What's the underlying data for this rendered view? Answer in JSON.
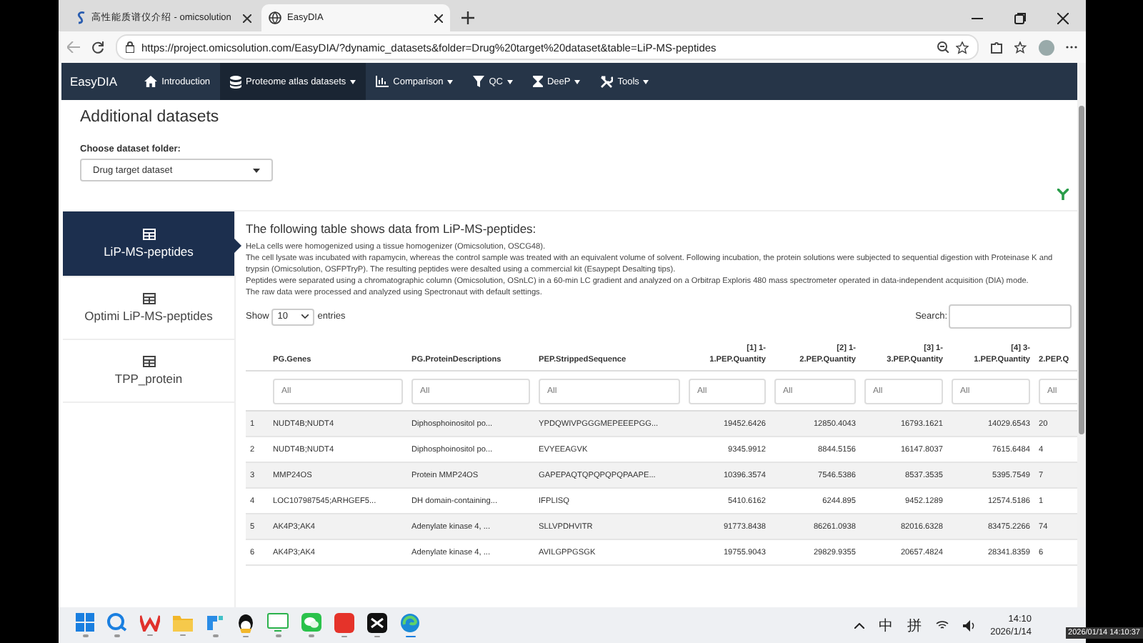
{
  "browser": {
    "tabs": [
      {
        "title": "高性能质谱仪介绍 - omicsolution",
        "selected": false
      },
      {
        "title": "EasyDIA",
        "selected": true
      }
    ],
    "url": "https://project.omicsolution.com/EasyDIA/?dynamic_datasets&folder=Drug%20target%20dataset&table=LiP-MS-peptides"
  },
  "navbar": {
    "brand": "EasyDIA",
    "items": [
      {
        "label": "Introduction",
        "selected": false
      },
      {
        "label": "Proteome atlas datasets",
        "selected": true
      },
      {
        "label": "Comparison",
        "selected": false
      },
      {
        "label": "QC",
        "selected": false
      },
      {
        "label": "DeeP",
        "selected": false
      },
      {
        "label": "Tools",
        "selected": false
      }
    ]
  },
  "page_title": "Additional datasets",
  "folder_select": {
    "label": "Choose dataset folder:",
    "value": "Drug target dataset"
  },
  "sidebar": {
    "items": [
      {
        "label": "LiP-MS-peptides",
        "selected": true
      },
      {
        "label": "Optimi LiP-MS-peptides",
        "selected": false
      },
      {
        "label": "TPP_protein",
        "selected": false
      }
    ]
  },
  "heading": "The following table shows data from LiP-MS-peptides:",
  "description": [
    "HeLa cells were homogenized using a tissue homogenizer (Omicsolution, OSCG48).",
    "The cell lysate was incubated with rapamycin, whereas the control sample was treated with an equivalent volume of solvent. Following incubation, the protein solutions were subjected to sequential digestion with Proteinase K and trypsin (Omicsolution, OSFPTryP). The resulting peptides were desalted using a commercial kit (Esaypept Desalting tips).",
    "Peptides were separated using a chromatographic column (Omicsolution, OSnLC) in a 60-min LC gradient and analyzed on a Orbitrap Exploris 480 mass spectrometer operated in data-independent acquisition (DIA) mode.",
    "The raw data were processed and analyzed using Spectronaut with default settings."
  ],
  "length_control": {
    "prefix": "Show",
    "value": "10",
    "suffix": "entries"
  },
  "search": {
    "label": "Search:"
  },
  "table": {
    "columns": [
      {
        "label": "PG.Genes",
        "kind": "text",
        "placeholder": "All"
      },
      {
        "label": "PG.ProteinDescriptions",
        "kind": "text",
        "placeholder": "All"
      },
      {
        "label": "PEP.StrippedSequence",
        "kind": "text",
        "placeholder": "All"
      },
      {
        "label": "[1] 1-1.PEP.Quantity",
        "kind": "number",
        "placeholder": "All"
      },
      {
        "label": "[2] 1-2.PEP.Quantity",
        "kind": "number",
        "placeholder": "All"
      },
      {
        "label": "[3] 1-3.PEP.Quantity",
        "kind": "number",
        "placeholder": "All"
      },
      {
        "label": "[4] 3-1.PEP.Quantity",
        "kind": "number",
        "placeholder": "All"
      },
      {
        "label": "2.PEP.Q",
        "kind": "text",
        "placeholder": "All"
      }
    ],
    "rows": [
      {
        "index": "1",
        "cells": [
          "NUDT4B;NUDT4",
          "Diphosphoinositol po...",
          "YPDQWIVPGGGMEPEEEPGG...",
          "19452.6426",
          "12850.4043",
          "16793.1621",
          "14029.6543",
          "20"
        ]
      },
      {
        "index": "2",
        "cells": [
          "NUDT4B;NUDT4",
          "Diphosphoinositol po...",
          "EVYEEAGVK",
          "9345.9912",
          "8844.5156",
          "16147.8037",
          "7615.6484",
          "4"
        ]
      },
      {
        "index": "3",
        "cells": [
          "MMP24OS",
          "Protein MMP24OS",
          "GAPEPAQTQPQPQPQPAAPE...",
          "10396.3574",
          "7546.5386",
          "8537.3535",
          "5395.7549",
          "7"
        ]
      },
      {
        "index": "4",
        "cells": [
          "LOC107987545;ARHGEF5...",
          "DH domain-containing...",
          "IFPLISQ",
          "5410.6162",
          "6244.895",
          "9452.1289",
          "12574.5186",
          "1"
        ]
      },
      {
        "index": "5",
        "cells": [
          "AK4P3;AK4",
          "Adenylate kinase 4, ...",
          "SLLVPDHVITR",
          "91773.8438",
          "86261.0938",
          "82016.6328",
          "83475.2266",
          "74"
        ]
      },
      {
        "index": "6",
        "cells": [
          "AK4P3;AK4",
          "Adenylate kinase 4, ...",
          "AVILGPPGSGK",
          "19755.9043",
          "29829.9355",
          "20657.4824",
          "28341.8359",
          "6"
        ]
      }
    ]
  },
  "taskbar": {
    "apps": [
      {
        "selected": false
      },
      {
        "selected": false
      },
      {
        "selected": false
      },
      {
        "selected": false
      },
      {
        "selected": false
      },
      {
        "selected": false
      },
      {
        "selected": false
      },
      {
        "selected": false
      },
      {
        "selected": false
      },
      {
        "selected": false
      },
      {
        "selected": true
      }
    ],
    "tray": [
      "中",
      "拼"
    ],
    "time": "14:10",
    "date": "2026/1/14"
  },
  "recording_timestamp": "2026/01/14 14:10:37"
}
